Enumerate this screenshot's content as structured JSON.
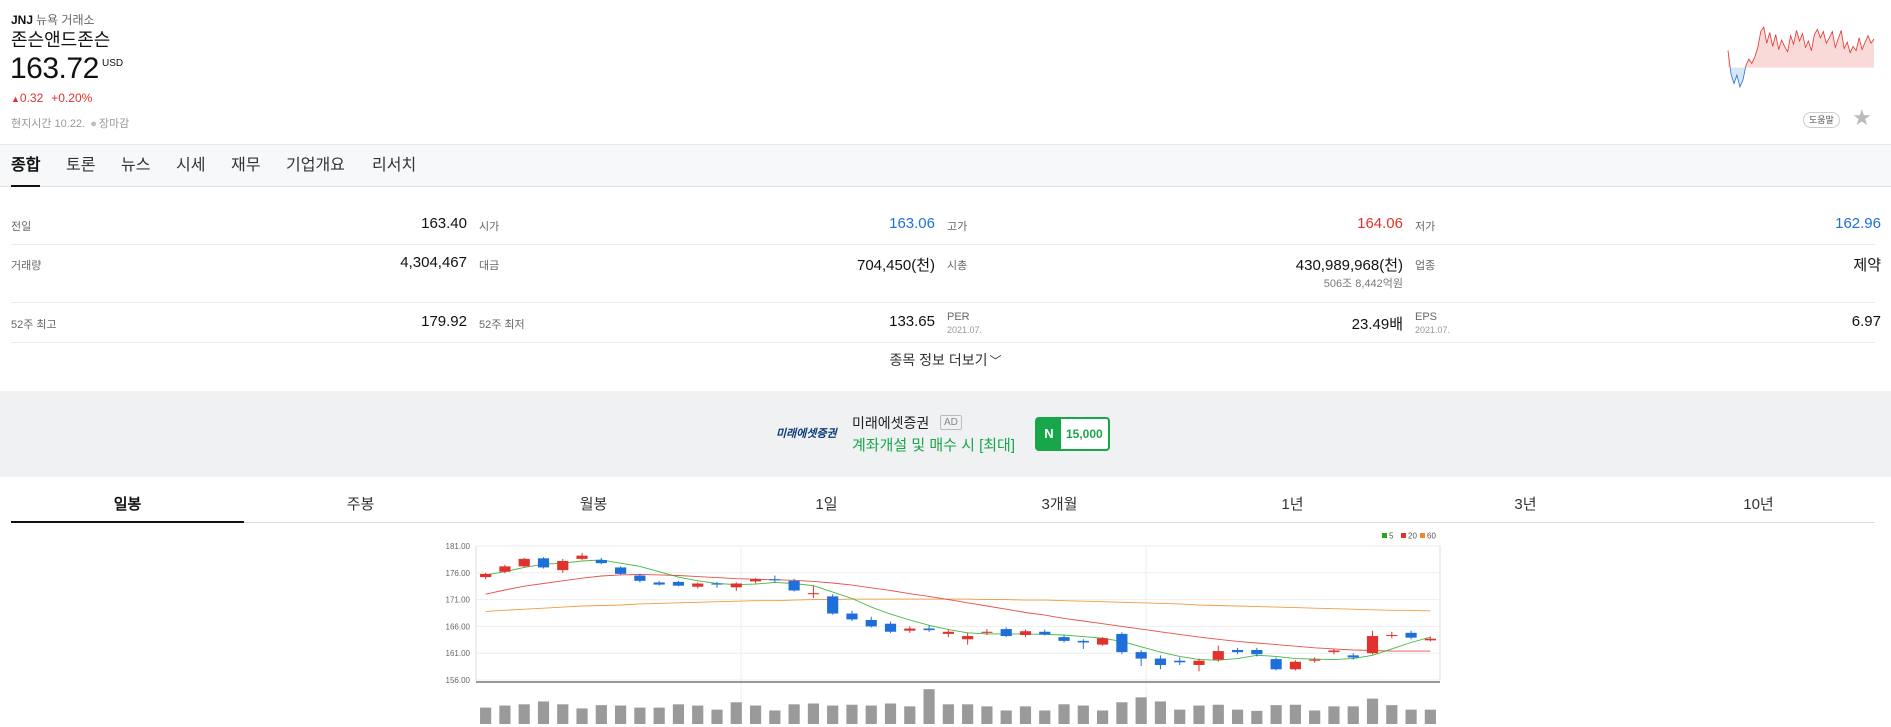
{
  "stock": {
    "symbol": "JNJ",
    "exchange": "뉴욕 거래소",
    "name": "존슨앤드존슨",
    "price": "163.72",
    "currency": "USD",
    "change_abs": "0.32",
    "change_pct": "+0.20%",
    "time_label": "현지시간 10.22.",
    "market_status": "장마감"
  },
  "header": {
    "help_label": "도움말",
    "star_icon": "star-icon"
  },
  "tabs": [
    {
      "label": "종합",
      "active": true
    },
    {
      "label": "토론"
    },
    {
      "label": "뉴스"
    },
    {
      "label": "시세"
    },
    {
      "label": "재무"
    },
    {
      "label": "기업개요"
    },
    {
      "label": "리서치"
    }
  ],
  "info_rows": [
    [
      {
        "label": "전일",
        "value": "163.40"
      },
      {
        "label": "시가",
        "value": "163.06",
        "color": "#1e6fd9"
      },
      {
        "label": "고가",
        "value": "164.06",
        "color": "#e2322d"
      },
      {
        "label": "저가",
        "value": "162.96",
        "color": "#1e6fd9"
      }
    ],
    [
      {
        "label": "거래량",
        "value": "4,304,467"
      },
      {
        "label": "대금",
        "value": "704,450(천)"
      },
      {
        "label": "시총",
        "value": "430,989,968(천)",
        "sub_value": "506조 8,442억원"
      },
      {
        "label": "업종",
        "value": "제약"
      }
    ],
    [
      {
        "label": "52주 최고",
        "value": "179.92"
      },
      {
        "label": "52주 최저",
        "value": "133.65"
      },
      {
        "label": "PER",
        "sub_label": "2021.07.",
        "value": "23.49배"
      },
      {
        "label": "EPS",
        "sub_label": "2021.07.",
        "value": "6.97"
      }
    ]
  ],
  "more_info_label": "종목 정보 더보기",
  "ad": {
    "logo_text": "미래에셋증권",
    "brand": "미래에셋증권",
    "tag": "AD",
    "description": "계좌개설 및 매수 시 [최대]",
    "point_icon": "N",
    "points": "15,000",
    "colors": {
      "accent": "#19a64b",
      "logo": "#0a3a78"
    }
  },
  "period_tabs": [
    {
      "label": "일봉",
      "active": true
    },
    {
      "label": "주봉"
    },
    {
      "label": "월봉"
    },
    {
      "label": "1일"
    },
    {
      "label": "3개월"
    },
    {
      "label": "1년"
    },
    {
      "label": "3년"
    },
    {
      "label": "10년"
    }
  ],
  "chart_data": {
    "type": "candlestick",
    "y_ticks": [
      "181.00",
      "176.00",
      "171.00",
      "166.00",
      "161.00",
      "156.00"
    ],
    "ylim": [
      156,
      181
    ],
    "grid": true,
    "legend_position": "top-right",
    "legend": [
      {
        "name": "5",
        "color": "#22aa22"
      },
      {
        "name": "20",
        "color": "#e2322d"
      },
      {
        "name": "60",
        "color": "#f08a24"
      }
    ],
    "colors": {
      "up": "#e2322d",
      "down": "#1e6fd9"
    },
    "candles": [
      {
        "o": 175.2,
        "h": 176.0,
        "l": 174.8,
        "c": 175.8
      },
      {
        "o": 176.2,
        "h": 177.5,
        "l": 175.9,
        "c": 177.2
      },
      {
        "o": 177.2,
        "h": 178.8,
        "l": 177.0,
        "c": 178.6
      },
      {
        "o": 178.7,
        "h": 178.9,
        "l": 176.8,
        "c": 177.0
      },
      {
        "o": 176.5,
        "h": 178.6,
        "l": 176.0,
        "c": 178.2
      },
      {
        "o": 178.6,
        "h": 179.7,
        "l": 178.4,
        "c": 179.2
      },
      {
        "o": 178.4,
        "h": 178.8,
        "l": 177.6,
        "c": 177.8
      },
      {
        "o": 177.0,
        "h": 177.2,
        "l": 175.6,
        "c": 175.8
      },
      {
        "o": 175.5,
        "h": 175.8,
        "l": 174.2,
        "c": 174.5
      },
      {
        "o": 174.2,
        "h": 174.5,
        "l": 173.6,
        "c": 173.8
      },
      {
        "o": 174.3,
        "h": 174.5,
        "l": 173.5,
        "c": 173.6
      },
      {
        "o": 173.4,
        "h": 174.2,
        "l": 173.1,
        "c": 174.0
      },
      {
        "o": 174.0,
        "h": 174.3,
        "l": 173.2,
        "c": 173.8
      },
      {
        "o": 173.3,
        "h": 174.2,
        "l": 172.6,
        "c": 174.0
      },
      {
        "o": 174.4,
        "h": 175.0,
        "l": 174.0,
        "c": 174.8
      },
      {
        "o": 174.8,
        "h": 175.5,
        "l": 174.2,
        "c": 174.6
      },
      {
        "o": 174.5,
        "h": 174.9,
        "l": 172.5,
        "c": 172.7
      },
      {
        "o": 172.0,
        "h": 173.6,
        "l": 171.3,
        "c": 172.2
      },
      {
        "o": 171.6,
        "h": 172.0,
        "l": 168.2,
        "c": 168.4
      },
      {
        "o": 168.4,
        "h": 168.9,
        "l": 167.0,
        "c": 167.3
      },
      {
        "o": 167.2,
        "h": 167.8,
        "l": 165.8,
        "c": 166.0
      },
      {
        "o": 166.5,
        "h": 166.9,
        "l": 164.8,
        "c": 165.0
      },
      {
        "o": 165.2,
        "h": 166.0,
        "l": 164.8,
        "c": 165.6
      },
      {
        "o": 165.6,
        "h": 166.2,
        "l": 165.0,
        "c": 165.3
      },
      {
        "o": 164.6,
        "h": 165.4,
        "l": 164.0,
        "c": 165.0
      },
      {
        "o": 163.6,
        "h": 164.8,
        "l": 162.6,
        "c": 164.2
      },
      {
        "o": 164.8,
        "h": 165.5,
        "l": 164.4,
        "c": 165.0
      },
      {
        "o": 165.5,
        "h": 165.8,
        "l": 164.0,
        "c": 164.2
      },
      {
        "o": 164.4,
        "h": 165.4,
        "l": 164.0,
        "c": 165.1
      },
      {
        "o": 165.0,
        "h": 165.4,
        "l": 164.3,
        "c": 164.5
      },
      {
        "o": 164.0,
        "h": 164.4,
        "l": 163.0,
        "c": 163.3
      },
      {
        "o": 163.3,
        "h": 163.6,
        "l": 161.8,
        "c": 163.0
      },
      {
        "o": 162.6,
        "h": 164.0,
        "l": 162.4,
        "c": 163.8
      },
      {
        "o": 164.6,
        "h": 164.9,
        "l": 160.8,
        "c": 161.2
      },
      {
        "o": 161.2,
        "h": 161.6,
        "l": 158.6,
        "c": 160.0
      },
      {
        "o": 160.0,
        "h": 160.6,
        "l": 158.0,
        "c": 158.8
      },
      {
        "o": 159.6,
        "h": 160.2,
        "l": 158.8,
        "c": 159.3
      },
      {
        "o": 158.8,
        "h": 160.0,
        "l": 157.6,
        "c": 159.6
      },
      {
        "o": 159.8,
        "h": 162.4,
        "l": 159.4,
        "c": 161.4
      },
      {
        "o": 161.6,
        "h": 162.0,
        "l": 160.8,
        "c": 161.2
      },
      {
        "o": 161.6,
        "h": 162.0,
        "l": 160.4,
        "c": 160.8
      },
      {
        "o": 159.9,
        "h": 160.2,
        "l": 157.8,
        "c": 158.0
      },
      {
        "o": 158.0,
        "h": 159.7,
        "l": 157.8,
        "c": 159.4
      },
      {
        "o": 159.6,
        "h": 160.2,
        "l": 159.2,
        "c": 159.8
      },
      {
        "o": 161.2,
        "h": 161.8,
        "l": 160.8,
        "c": 161.5
      },
      {
        "o": 160.6,
        "h": 161.0,
        "l": 159.8,
        "c": 160.2
      },
      {
        "o": 161.0,
        "h": 165.2,
        "l": 160.8,
        "c": 164.2
      },
      {
        "o": 164.4,
        "h": 165.0,
        "l": 163.8,
        "c": 164.4
      },
      {
        "o": 164.8,
        "h": 165.2,
        "l": 163.6,
        "c": 163.9
      },
      {
        "o": 163.4,
        "h": 164.1,
        "l": 163.2,
        "c": 163.7
      }
    ],
    "ma5": [
      175.6,
      176.2,
      177.0,
      177.6,
      177.8,
      178.2,
      178.4,
      177.8,
      177.2,
      176.2,
      175.2,
      174.5,
      174.0,
      173.8,
      173.9,
      174.2,
      174.0,
      173.6,
      172.4,
      171.2,
      169.6,
      168.3,
      167.2,
      166.2,
      165.4,
      164.8,
      164.6,
      164.6,
      164.6,
      164.5,
      164.4,
      164.1,
      163.8,
      163.2,
      162.2,
      161.2,
      160.4,
      159.8,
      159.7,
      160.0,
      160.6,
      160.4,
      160.0,
      159.9,
      159.8,
      160.0,
      160.6,
      161.8,
      163.0,
      164.0
    ],
    "ma20": [
      172.0,
      172.8,
      173.5,
      174.0,
      174.5,
      175.0,
      175.4,
      175.6,
      175.7,
      175.6,
      175.5,
      175.3,
      175.1,
      174.9,
      174.8,
      174.7,
      174.6,
      174.4,
      174.1,
      173.7,
      173.2,
      172.7,
      172.1,
      171.6,
      171.0,
      170.4,
      169.8,
      169.2,
      168.6,
      168.1,
      167.5,
      167.0,
      166.5,
      166.0,
      165.5,
      165.0,
      164.5,
      164.0,
      163.6,
      163.2,
      162.9,
      162.6,
      162.3,
      162.0,
      161.8,
      161.6,
      161.5,
      161.4,
      161.4,
      161.4
    ],
    "ma60": [
      168.8,
      169.0,
      169.2,
      169.4,
      169.6,
      169.8,
      169.9,
      170.0,
      170.2,
      170.3,
      170.4,
      170.5,
      170.6,
      170.7,
      170.8,
      170.8,
      170.9,
      171.0,
      171.0,
      171.1,
      171.1,
      171.1,
      171.1,
      171.1,
      171.1,
      171.1,
      171.0,
      171.0,
      170.9,
      170.9,
      170.8,
      170.7,
      170.6,
      170.5,
      170.4,
      170.3,
      170.2,
      170.0,
      169.9,
      169.8,
      169.7,
      169.6,
      169.5,
      169.4,
      169.3,
      169.2,
      169.1,
      169.0,
      169.0,
      168.9
    ],
    "volume": [
      0.4,
      0.45,
      0.48,
      0.55,
      0.48,
      0.38,
      0.46,
      0.45,
      0.4,
      0.4,
      0.48,
      0.45,
      0.35,
      0.53,
      0.45,
      0.33,
      0.48,
      0.5,
      0.45,
      0.47,
      0.45,
      0.5,
      0.43,
      0.85,
      0.48,
      0.48,
      0.43,
      0.33,
      0.43,
      0.33,
      0.48,
      0.45,
      0.33,
      0.53,
      0.65,
      0.55,
      0.35,
      0.45,
      0.47,
      0.35,
      0.32,
      0.46,
      0.47,
      0.33,
      0.43,
      0.43,
      0.62,
      0.46,
      0.35,
      0.35
    ]
  },
  "mini_chart": {
    "type": "line",
    "values": [
      165.0,
      162.8,
      161.9,
      162.7,
      161.6,
      162.2,
      163.6,
      164.2,
      163.8,
      164.4,
      165.3,
      166.8,
      167.2,
      165.7,
      166.7,
      165.4,
      166.5,
      165.1,
      166.0,
      165.4,
      164.9,
      166.4,
      165.6,
      166.9,
      165.9,
      166.6,
      165.3,
      165.9,
      165.0,
      166.5,
      167.0,
      166.2,
      166.8,
      165.7,
      166.2,
      166.8,
      165.3,
      166.1,
      166.9,
      165.2,
      165.8,
      164.8,
      165.4,
      165.0,
      166.2,
      165.1,
      165.8,
      166.4,
      165.7,
      166.1
    ],
    "baseline": 163.4,
    "colors": {
      "up": "#e2322d",
      "down": "#1e6fd9"
    }
  }
}
